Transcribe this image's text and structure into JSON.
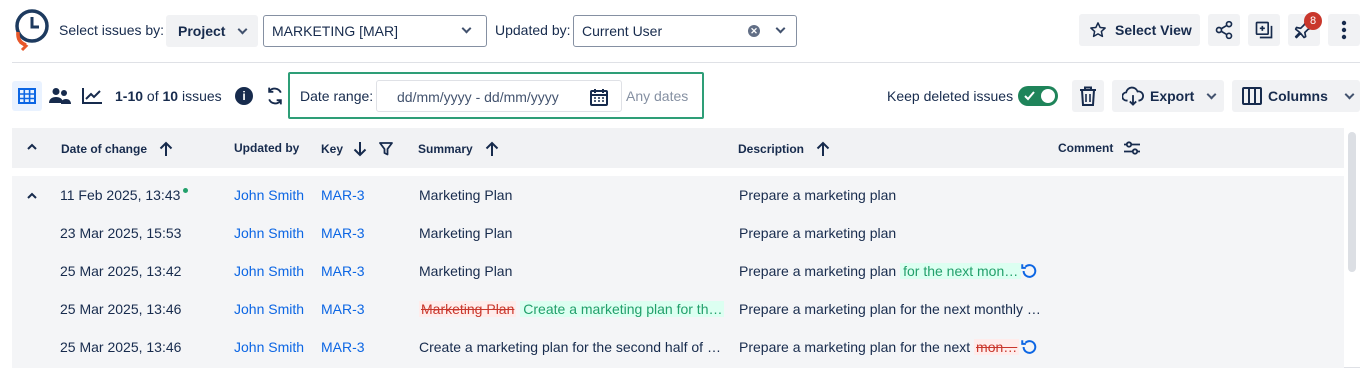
{
  "header": {
    "select_issues_label": "Select issues by:",
    "project_dropdown": "Project",
    "project_value": "MARKETING [MAR]",
    "updated_by_label": "Updated by:",
    "updated_by_value": "Current User",
    "select_view": "Select View",
    "notification_count": "8"
  },
  "toolbar": {
    "issues_range": "1-10",
    "issues_of": "of",
    "issues_total": "10",
    "issues_word": "issues",
    "date_range_label": "Date range:",
    "date_range_placeholder": "dd/mm/yyyy - dd/mm/yyyy",
    "any_dates": "Any dates",
    "keep_deleted_label": "Keep deleted issues",
    "keep_deleted_on": true,
    "export_label": "Export",
    "columns_label": "Columns"
  },
  "table": {
    "columns": {
      "date": "Date of change",
      "updated_by": "Updated by",
      "key": "Key",
      "summary": "Summary",
      "description": "Description",
      "comment": "Comment"
    },
    "rows": [
      {
        "date": "11 Feb 2025, 13:43",
        "user": "John Smith",
        "key": "MAR-3",
        "summary": "Marketing Plan",
        "desc": "Prepare a marketing plan"
      },
      {
        "date": "23 Mar 2025, 15:53",
        "user": "John Smith",
        "key": "MAR-3",
        "summary": "Marketing Plan",
        "desc": "Prepare a marketing plan"
      },
      {
        "date": "25 Mar 2025, 13:42",
        "user": "John Smith",
        "key": "MAR-3",
        "summary": "Marketing Plan",
        "desc": "Prepare a marketing plan",
        "desc_added": "for the next mon…"
      },
      {
        "date": "25 Mar 2025, 13:46",
        "user": "John Smith",
        "key": "MAR-3",
        "summary_removed": "Marketing Plan",
        "summary_added": "Create a marketing plan for th…",
        "desc": "Prepare a marketing plan for the next monthly …"
      },
      {
        "date": "25 Mar 2025, 13:46",
        "user": "John Smith",
        "key": "MAR-3",
        "summary": "Create a marketing plan for the second half of …",
        "desc": "Prepare a marketing plan for the next",
        "desc_removed": "mon…"
      }
    ]
  },
  "colors": {
    "accent": "#0c66e4",
    "highlight_border": "#2e9e77",
    "toggle": "#1f845a",
    "badge": "#c9372c"
  }
}
